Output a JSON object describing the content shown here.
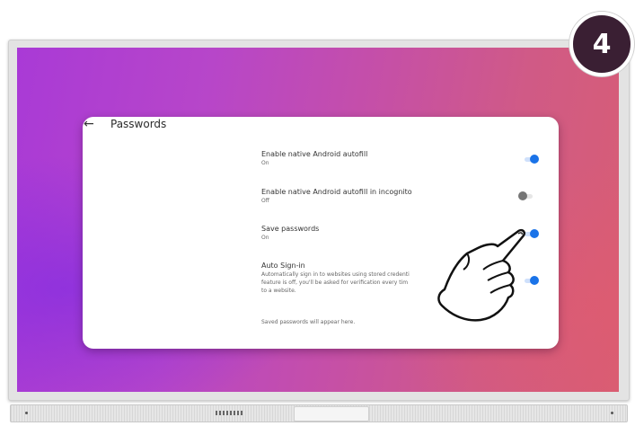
{
  "step_badge": {
    "number": "4"
  },
  "passwords_page": {
    "back_icon": "arrow-left-icon",
    "title": "Passwords",
    "settings": [
      {
        "label": "Enable native Android autofill",
        "status": "On",
        "enabled": true
      },
      {
        "label": "Enable native Android autofill in incognito",
        "status": "Off",
        "enabled": false
      },
      {
        "label": "Save passwords",
        "status": "On",
        "enabled": true
      },
      {
        "label": "Auto Sign-in",
        "description_line1": "Automatically sign in to websites using stored credenti",
        "description_line2": "feature is off, you'll be asked for verification every tim",
        "description_line3": "to a website.",
        "enabled": true
      }
    ],
    "empty_hint": "Saved passwords will appear here."
  },
  "colors": {
    "accent": "#1a73e8",
    "badge_bg": "#3a1f33",
    "wallpaper_start": "#a93ad6",
    "wallpaper_end": "#d85e73"
  },
  "overlay": {
    "pointer_icon": "pointing-hand-icon"
  }
}
